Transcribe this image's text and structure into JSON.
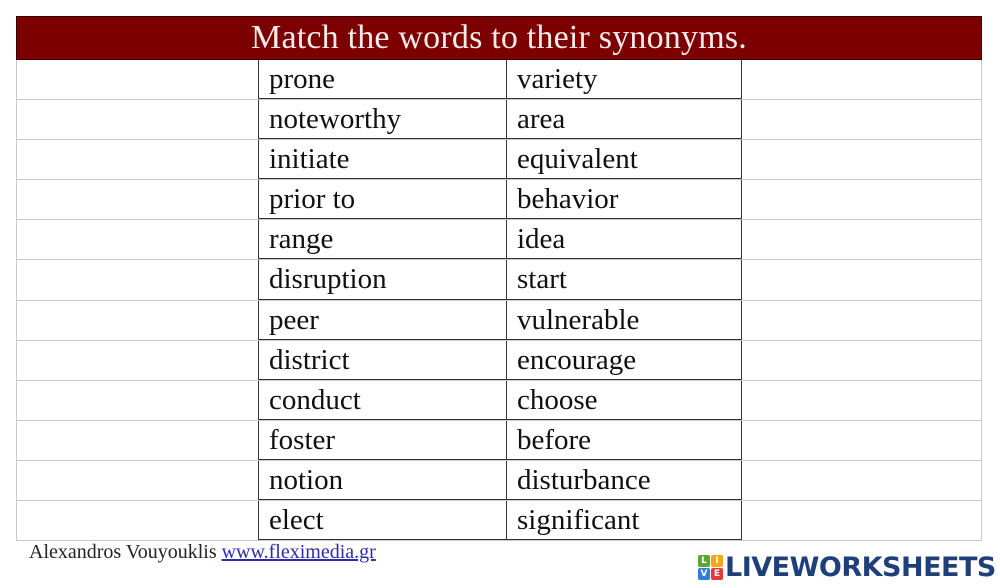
{
  "title": "Match the words to their synonyms.",
  "rows": [
    {
      "word": "prone",
      "synonym": "variety"
    },
    {
      "word": "noteworthy",
      "synonym": "area"
    },
    {
      "word": "initiate",
      "synonym": "equivalent"
    },
    {
      "word": "prior to",
      "synonym": "behavior"
    },
    {
      "word": "range",
      "synonym": "idea"
    },
    {
      "word": "disruption",
      "synonym": "start"
    },
    {
      "word": "peer",
      "synonym": "vulnerable"
    },
    {
      "word": "district",
      "synonym": "encourage"
    },
    {
      "word": "conduct",
      "synonym": "choose"
    },
    {
      "word": "foster",
      "synonym": "before"
    },
    {
      "word": "notion",
      "synonym": "disturbance"
    },
    {
      "word": "elect",
      "synonym": "significant"
    }
  ],
  "footer": {
    "author": "Alexandros Vouyouklis",
    "link_text": "www.fleximedia.gr"
  },
  "brand": {
    "logo_letters": [
      "L",
      "I",
      "V",
      "E"
    ],
    "logo_colors": [
      "#5aa832",
      "#f2a818",
      "#2f7fd0",
      "#e03a3a"
    ],
    "name": "LIVEWORKSHEETS"
  },
  "colors": {
    "header_bg": "#7d0000",
    "brand_text": "#1f3f7a",
    "link": "#2a2ab0"
  }
}
